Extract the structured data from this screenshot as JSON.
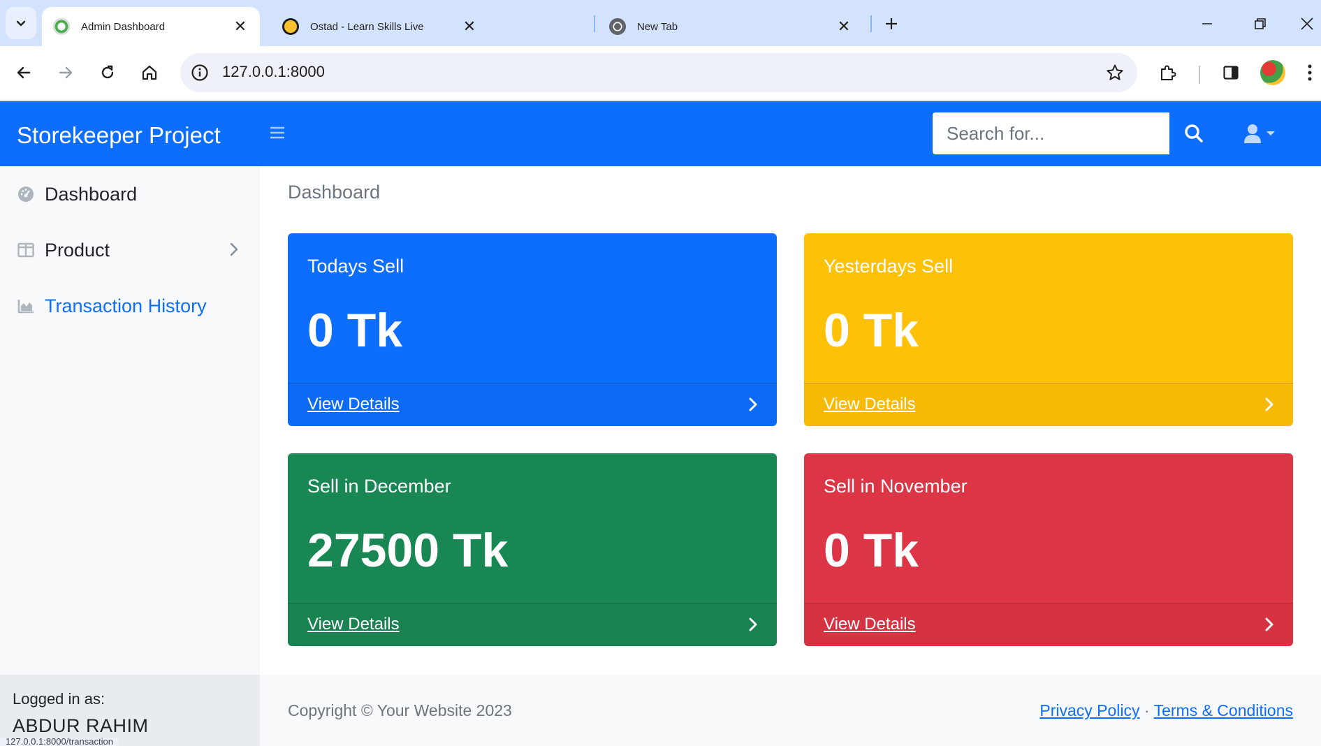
{
  "browser": {
    "tabs": [
      {
        "title": "Admin Dashboard",
        "active": true
      },
      {
        "title": "Ostad - Learn Skills Live",
        "active": false
      },
      {
        "title": "New Tab",
        "active": false
      }
    ],
    "url": "127.0.0.1:8000",
    "status_url": "127.0.0.1:8000/transaction"
  },
  "navbar": {
    "brand": "Storekeeper Project",
    "search_placeholder": "Search for..."
  },
  "sidebar": {
    "items": [
      {
        "label": "Dashboard",
        "icon": "dashboard-icon"
      },
      {
        "label": "Product",
        "icon": "columns-icon"
      },
      {
        "label": "Transaction History",
        "icon": "chart-area-icon"
      }
    ],
    "footer": {
      "label": "Logged in as:",
      "user": "ABDUR RAHIM"
    }
  },
  "main": {
    "title": "Dashboard",
    "cards": [
      {
        "title": "Todays Sell",
        "value": "0 Tk",
        "link": "View Details",
        "color": "#0d6efd"
      },
      {
        "title": "Yesterdays Sell",
        "value": "0 Tk",
        "link": "View Details",
        "color": "#ffc107"
      },
      {
        "title": "Sell in December",
        "value": "27500 Tk",
        "link": "View Details",
        "color": "#198754"
      },
      {
        "title": "Sell in November",
        "value": "0 Tk",
        "link": "View Details",
        "color": "#dc3545"
      }
    ],
    "footer": {
      "copyright": "Copyright © Your Website 2023",
      "privacy": "Privacy Policy",
      "separator": "·",
      "terms": "Terms & Conditions"
    }
  }
}
